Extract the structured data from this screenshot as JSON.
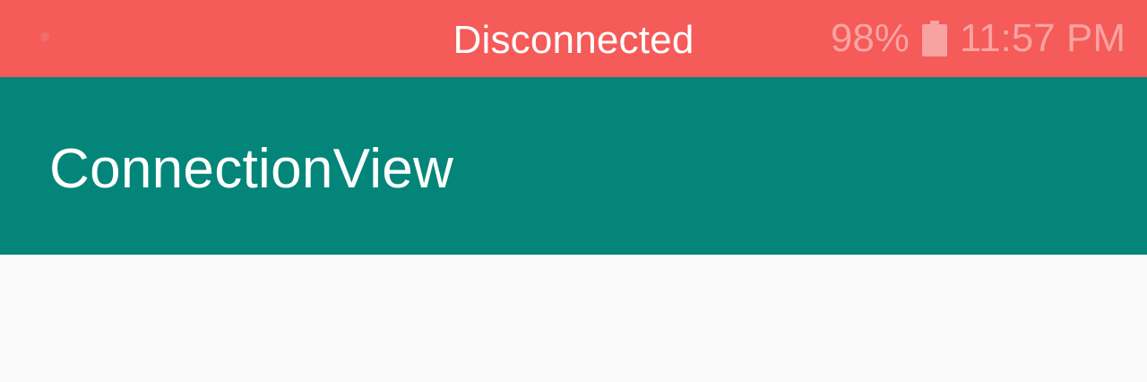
{
  "status_bar": {
    "connection_status": "Disconnected",
    "battery_level": "98%",
    "time": "11:57 PM",
    "background_color": "#f45b59",
    "icons": [
      "notification-dot-icon",
      "battery-icon"
    ]
  },
  "app_bar": {
    "title": "ConnectionView",
    "background_color": "#038679"
  },
  "content": {
    "background_color": "#fafafa"
  }
}
